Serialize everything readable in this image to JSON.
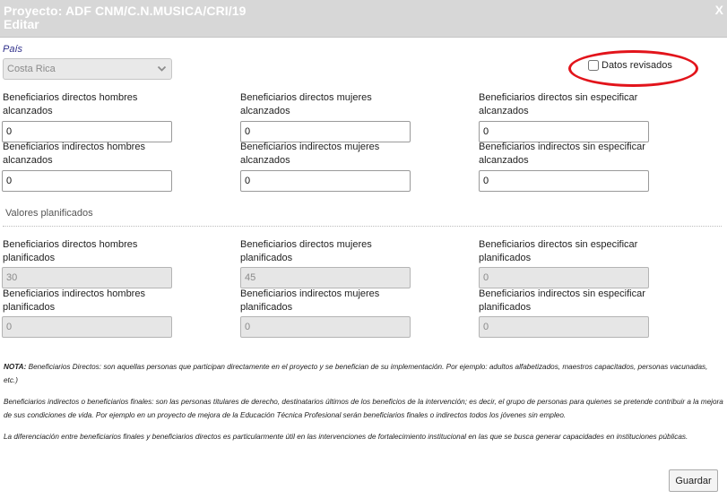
{
  "dialog": {
    "title_line1": "Proyecto: ADF CNM/C.N.MUSICA/CRI/19",
    "title_line2": "Editar",
    "close_label": "X"
  },
  "pais": {
    "label": "País",
    "value": "Costa Rica"
  },
  "datos_revisados": {
    "label": "Datos revisados",
    "checked": false
  },
  "alcanzados": {
    "directos_hombres": {
      "label_1": "Beneficiarios directos hombres",
      "label_2": "alcanzados",
      "value": "0"
    },
    "directos_mujeres": {
      "label_1": "Beneficiarios directos mujeres",
      "label_2": "alcanzados",
      "value": "0"
    },
    "directos_sin": {
      "label_1": "Beneficiarios directos sin especificar",
      "label_2": "alcanzados",
      "value": "0"
    },
    "indirectos_hombres": {
      "label_1": "Beneficiarios indirectos hombres",
      "label_2": "alcanzados",
      "value": "0"
    },
    "indirectos_mujeres": {
      "label_1": "Beneficiarios indirectos mujeres",
      "label_2": "alcanzados",
      "value": "0"
    },
    "indirectos_sin": {
      "label_1": "Beneficiarios indirectos sin especificar",
      "label_2": "alcanzados",
      "value": "0"
    }
  },
  "planificados_section": {
    "title": "Valores planificados"
  },
  "planificados": {
    "directos_hombres": {
      "label_1": "Beneficiarios directos hombres",
      "label_2": "planificados",
      "value": "30"
    },
    "directos_mujeres": {
      "label_1": "Beneficiarios directos mujeres",
      "label_2": "planificados",
      "value": "45"
    },
    "directos_sin": {
      "label_1": "Beneficiarios directos sin especificar",
      "label_2": "planificados",
      "value": "0"
    },
    "indirectos_hombres": {
      "label_1": "Beneficiarios indirectos hombres",
      "label_2": "planificados",
      "value": "0"
    },
    "indirectos_mujeres": {
      "label_1": "Beneficiarios indirectos mujeres",
      "label_2": "planificados",
      "value": "0"
    },
    "indirectos_sin": {
      "label_1": "Beneficiarios indirectos sin especificar",
      "label_2": "planificados",
      "value": "0"
    }
  },
  "notes": {
    "nota_label": "NOTA:",
    "nota_text": " Beneficiarios Directos: son aquellas personas que participan directamente en el proyecto y se benefician de su implementación. Por ejemplo: adultos alfabetizados, maestros capacitados, personas vacunadas, etc.)",
    "indirectos_text": "Beneficiarios indirectos o beneficiarios finales: son las personas titulares de derecho, destinatarios últimos de los beneficios de la intervención; es decir, el grupo de personas para quienes se pretende contribuir a la mejora de sus condiciones de vida. Por ejemplo en un proyecto de mejora de la Educación Técnica Profesional serán beneficiarios finales o indirectos todos los jóvenes sin empleo.",
    "diferenciacion_text": "La diferenciación entre beneficiarios finales y beneficiarios directos es particularmente útil en las intervenciones de fortalecimiento institucional en las que se busca generar capacidades en instituciones públicas."
  },
  "actions": {
    "save_label": "Guardar"
  },
  "colors": {
    "titlebar_bg": "#d7d7d7",
    "highlight_oval": "#e2141b",
    "label_blue": "#2e2e8a"
  }
}
